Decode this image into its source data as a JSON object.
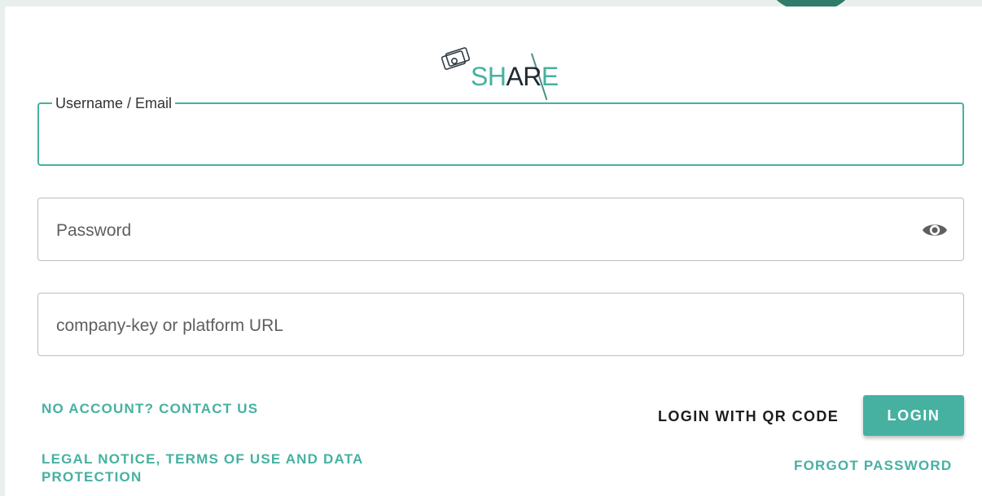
{
  "brand": {
    "logo_prefix": "SH",
    "logo_mid": "AR",
    "logo_suffix": "E",
    "accent_color": "#46b1a0"
  },
  "form": {
    "username": {
      "label": "Username / Email",
      "value": ""
    },
    "password": {
      "placeholder": "Password",
      "toggle_icon": "eye-icon"
    },
    "company": {
      "placeholder": "company-key or platform URL"
    }
  },
  "actions": {
    "contact_link": "NO ACCOUNT? CONTACT US",
    "qr_login": "LOGIN WITH QR CODE",
    "login": "LOGIN",
    "legal_line1": "LEGAL NOTICE, TERMS OF USE AND DATA",
    "legal_line2": "PROTECTION",
    "forgot_password": "FORGOT PASSWORD"
  }
}
